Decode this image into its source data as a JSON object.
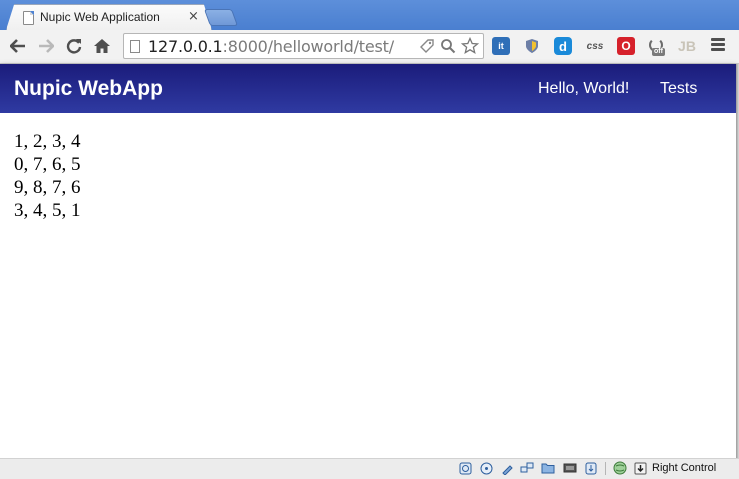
{
  "browser": {
    "tab_title": "Nupic Web Application",
    "tab_close": "×",
    "url": {
      "host": "127.0.0.1",
      "port": ":8000",
      "path": "/helloworld/test/"
    },
    "nav_icons": {
      "back": "arrow-left-icon",
      "forward": "arrow-right-icon",
      "reload": "reload-icon",
      "home": "home-icon"
    },
    "extensions": {
      "it_label": "it",
      "d_label": "d",
      "css_label": "css",
      "opera_label": "O",
      "off_badge": "off",
      "jb_label": "JB"
    }
  },
  "app": {
    "brand": "Nupic WebApp",
    "nav_links": [
      "Hello, World!",
      "Tests"
    ],
    "colors": {
      "navbar_top": "#1b1c7b",
      "navbar_bottom": "#2f3aa2"
    }
  },
  "content": {
    "rows": [
      "1, 2, 3, 4",
      "0, 7, 6, 5",
      "9, 8, 7, 6",
      "3, 4, 5, 1"
    ]
  },
  "statusbar": {
    "host_key_label": "Right Control"
  }
}
